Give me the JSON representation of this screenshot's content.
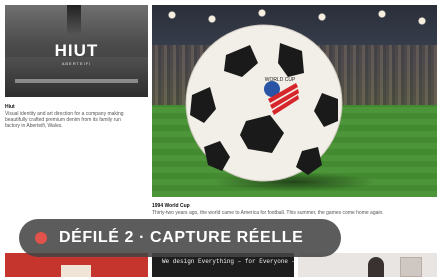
{
  "cards": {
    "left": {
      "logo": "HIUT",
      "logo_sub": "ABERTEIFI",
      "title": "Hiut",
      "desc_lines": [
        "Visual identity and art direction for a company making",
        "beautifully crafted premium denim from its family run",
        "factory in Aberteifi, Wales."
      ]
    },
    "main": {
      "ball_text": "WORLD CUP USA 94",
      "title": "1994 World Cup",
      "desc": "Thirty-two years ago, the world came to America for football. This summer, the games come home again."
    }
  },
  "overlay": {
    "label": "DÉFILÉ 2 · CAPTURE RÉELLE",
    "dot_color": "#e0524a"
  },
  "bottom_row": {
    "design_text": "We design Everything – for Everyone –"
  }
}
